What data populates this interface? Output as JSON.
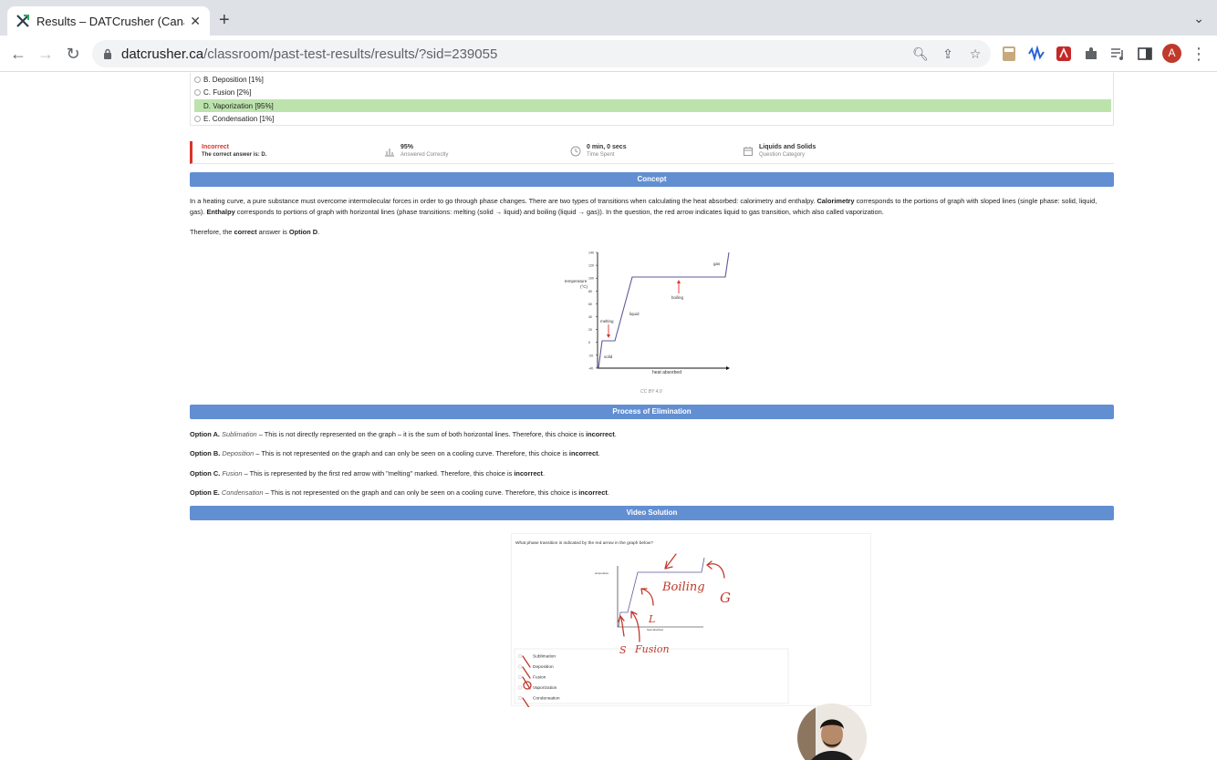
{
  "browser": {
    "tab_title": "Results – DATCrusher (Canadia",
    "close_label": "✕",
    "new_tab_label": "+",
    "url_host": "datcrusher.ca",
    "url_path": "/classroom/past-test-results/results/?sid=239055",
    "avatar_letter": "A"
  },
  "question": {
    "options": [
      {
        "label": "B. Deposition [1%]",
        "selected": false
      },
      {
        "label": "C. Fusion [2%]",
        "selected": false
      },
      {
        "label": "D. Vaporization [95%]",
        "selected": true
      },
      {
        "label": "E. Condensation [1%]",
        "selected": false
      }
    ]
  },
  "stats": {
    "result": "Incorrect",
    "correct_answer_text": "The correct answer is: D.",
    "percent": "95%",
    "percent_label": "Answered Correctly",
    "time": "0 min, 0 secs",
    "time_label": "Time Spent",
    "category": "Liquids and Solids",
    "category_label": "Question Category",
    "result_color": "#d9342b"
  },
  "sections": {
    "concept": "Concept",
    "elimination": "Process of Elimination",
    "video": "Video Solution"
  },
  "concept": {
    "p1_a": "In a heating curve, a pure substance must overcome intermolecular forces in order to go through phase changes. There are two types of transitions when calculating the heat absorbed: calorimetry and enthalpy. ",
    "p1_b": "Calorimetry",
    "p1_c": " corresponds to the portions of graph with sloped lines (single phase: solid, liquid, gas). ",
    "p1_d": "Enthalpy",
    "p1_e": " corresponds to portions of graph with horizontal lines (phase transitions: melting (solid → liquid) and boiling (liquid → gas)). In the question, the red arrow indicates liquid to gas transition, which also called vaporization.",
    "p2_a": "Therefore, the ",
    "p2_b": "correct",
    "p2_c": " answer is ",
    "p2_d": "Option D",
    "p2_e": "."
  },
  "graph": {
    "ylabel": "temperature",
    "yunit": "(°C)",
    "xlabel": "heat absorbed",
    "ticks": [
      "140",
      "120",
      "100",
      "80",
      "60",
      "40",
      "20",
      "0",
      "-20",
      "-40"
    ],
    "labels": {
      "gas": "gas",
      "boiling": "boiling",
      "liquid": "liquid",
      "melting": "melting",
      "solid": "solid"
    },
    "caption": "CC BY 4.0"
  },
  "elimination": [
    {
      "opt": "Option A.",
      "name": "Sublimation",
      "text": " – This is not directly represented on the graph – it is the sum of both horizontal lines. Therefore, this choice is ",
      "verdict": "incorrect",
      "end": "."
    },
    {
      "opt": "Option B.",
      "name": "Deposition",
      "text": " – This is not represented on the graph and can only be seen on a cooling curve. Therefore, this choice is ",
      "verdict": "incorrect",
      "end": "."
    },
    {
      "opt": "Option C.",
      "name": "Fusion",
      "text": " – This is represented by the first red arrow with \"melting\" marked. Therefore, this choice is ",
      "verdict": "incorrect",
      "end": "."
    },
    {
      "opt": "Option E.",
      "name": "Condensation",
      "text": " – This is not represented on the graph and can only be seen on a cooling curve. Therefore, this choice is ",
      "verdict": "incorrect",
      "end": "."
    }
  ],
  "video": {
    "question": "What phase transition is indicated by the red arrow in the graph below?",
    "options": [
      "Sublimation",
      "Deposition",
      "Fusion",
      "Vaporization",
      "Condensation"
    ],
    "annotations": {
      "boiling": "Boiling",
      "g": "G",
      "l": "L",
      "s": "S",
      "fusion": "Fusion"
    },
    "ink_color": "#c0392b"
  }
}
